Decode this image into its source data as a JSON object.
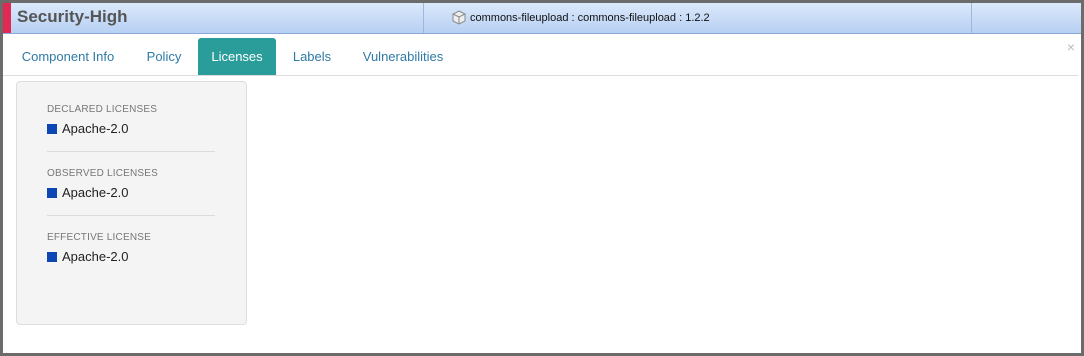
{
  "title_bar": {
    "policy_label": "Security-High",
    "severity_color": "#e02a53",
    "component_icon": "package-icon",
    "component_id": "commons-fileupload : commons-fileupload : 1.2.2"
  },
  "close_label": "×",
  "tabs": [
    {
      "label": "Component Info",
      "active": false
    },
    {
      "label": "Policy",
      "active": false
    },
    {
      "label": "Licenses",
      "active": true
    },
    {
      "label": "Labels",
      "active": false
    },
    {
      "label": "Vulnerabilities",
      "active": false
    }
  ],
  "licenses": {
    "swatch_color": "#0d47b5",
    "declared": {
      "heading": "DECLARED LICENSES",
      "items": [
        "Apache-2.0"
      ]
    },
    "observed": {
      "heading": "OBSERVED LICENSES",
      "items": [
        "Apache-2.0"
      ]
    },
    "effective": {
      "heading": "EFFECTIVE LICENSE",
      "items": [
        "Apache-2.0"
      ]
    }
  }
}
